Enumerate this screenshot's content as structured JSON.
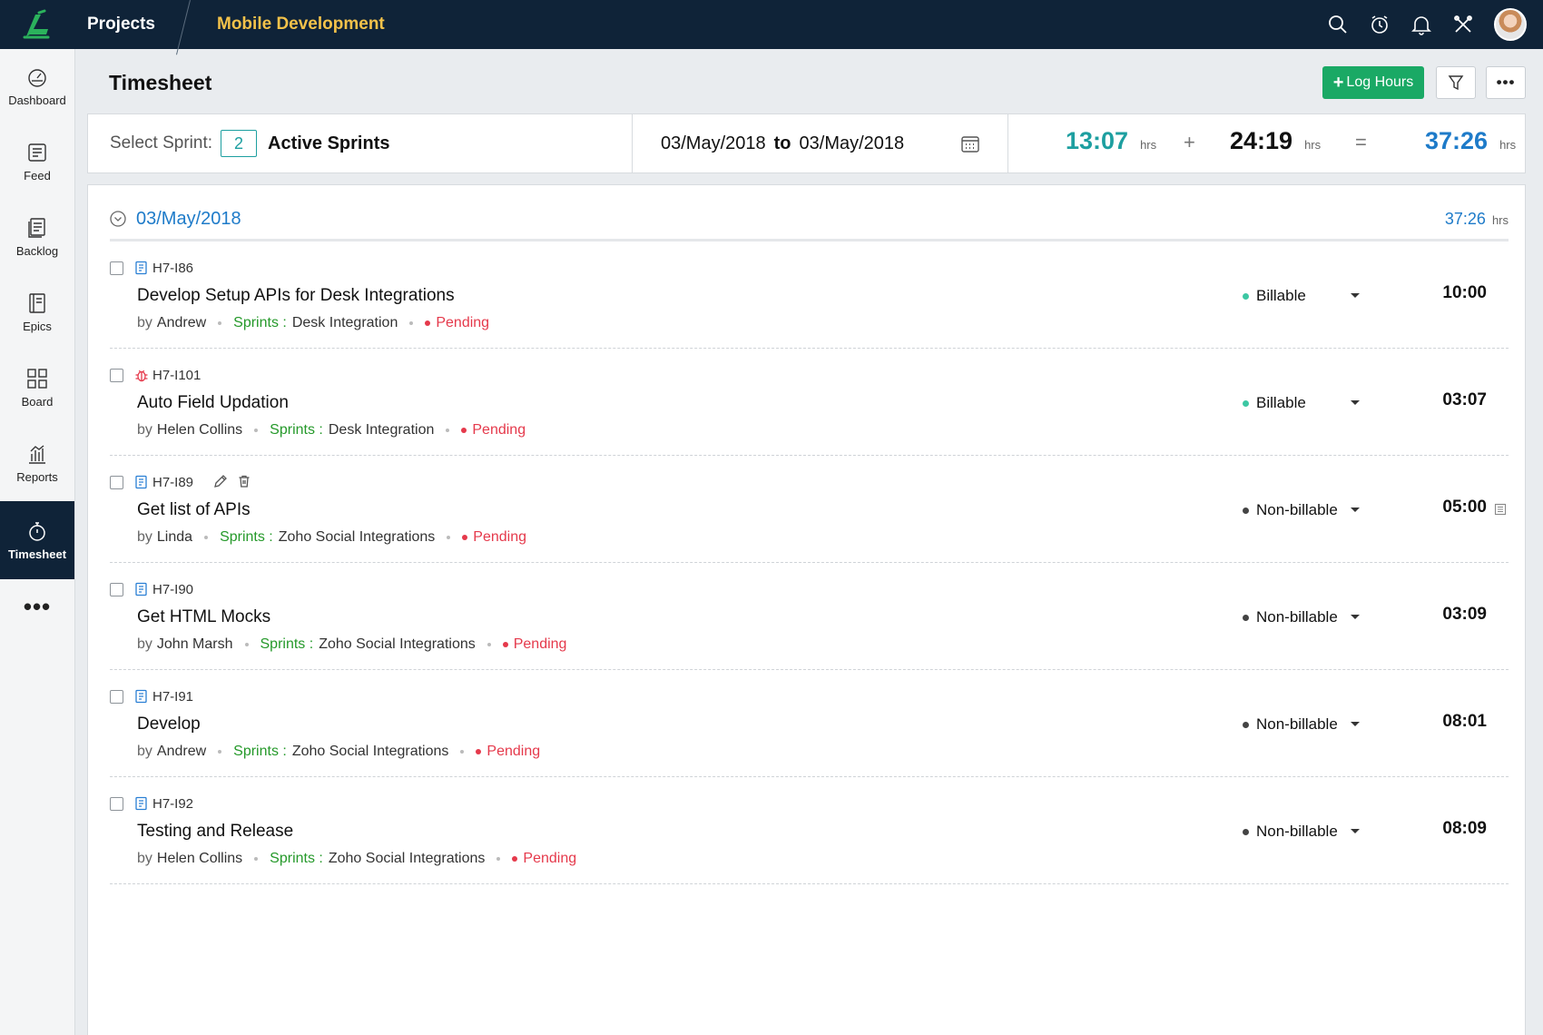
{
  "topbar": {
    "projects_label": "Projects",
    "project_name": "Mobile Development",
    "colors": {
      "bg": "#0f2338",
      "project_accent": "#f3c24a",
      "logo_green": "#2bb25c"
    }
  },
  "sidebar": {
    "items": [
      {
        "label": "Dashboard",
        "icon": "dashboard-gauge-icon"
      },
      {
        "label": "Feed",
        "icon": "feed-icon"
      },
      {
        "label": "Backlog",
        "icon": "backlog-icon"
      },
      {
        "label": "Epics",
        "icon": "epics-book-icon"
      },
      {
        "label": "Board",
        "icon": "board-grid-icon"
      },
      {
        "label": "Reports",
        "icon": "reports-chart-icon"
      },
      {
        "label": "Timesheet",
        "icon": "stopwatch-icon",
        "active": true
      }
    ],
    "more_label": "•••"
  },
  "header": {
    "title": "Timesheet",
    "log_hours_plus": "+",
    "log_hours_label": "Log Hours",
    "more_label": "•••"
  },
  "summary": {
    "select_sprint_label": "Select Sprint:",
    "sprint_count": "2",
    "sprint_name": "Active Sprints",
    "date_from": "03/May/2018",
    "date_to_label": "to",
    "date_to": "03/May/2018",
    "billable_hours": "13:07",
    "nonbillable_hours": "24:19",
    "total_hours": "37:26",
    "unit": "hrs",
    "plus": "+",
    "equals": "="
  },
  "day": {
    "date": "03/May/2018",
    "total": "37:26",
    "unit": "hrs"
  },
  "entries": [
    {
      "id": "H7-I86",
      "type_icon": "task-doc-icon",
      "title": "Develop Setup APIs for Desk Integrations",
      "by_label": "by",
      "author": "Andrew",
      "sprints_label": "Sprints :",
      "sprint": "Desk Integration",
      "status": "Pending",
      "billing": "Billable",
      "billing_color": "#3cc7a3",
      "duration": "10:00"
    },
    {
      "id": "H7-I101",
      "type_icon": "bug-icon",
      "title": "Auto Field Updation",
      "by_label": "by",
      "author": "Helen Collins",
      "sprints_label": "Sprints :",
      "sprint": "Desk Integration",
      "status": "Pending",
      "billing": "Billable",
      "billing_color": "#3cc7a3",
      "duration": "03:07"
    },
    {
      "id": "H7-I89",
      "type_icon": "task-doc-icon",
      "title": "Get list of APIs",
      "by_label": "by",
      "author": "Linda",
      "sprints_label": "Sprints :",
      "sprint": "Zoho Social Integrations",
      "status": "Pending",
      "billing": "Non-billable",
      "billing_color": "#444444",
      "duration": "05:00",
      "has_actions": true,
      "has_note": true
    },
    {
      "id": "H7-I90",
      "type_icon": "task-doc-icon",
      "title": "Get HTML Mocks",
      "by_label": "by",
      "author": "John Marsh",
      "sprints_label": "Sprints :",
      "sprint": "Zoho Social Integrations",
      "status": "Pending",
      "billing": "Non-billable",
      "billing_color": "#444444",
      "duration": "03:09"
    },
    {
      "id": "H7-I91",
      "type_icon": "task-doc-icon",
      "title": "Develop",
      "by_label": "by",
      "author": "Andrew",
      "sprints_label": "Sprints :",
      "sprint": "Zoho Social Integrations",
      "status": "Pending",
      "billing": "Non-billable",
      "billing_color": "#444444",
      "duration": "08:01"
    },
    {
      "id": "H7-I92",
      "type_icon": "task-doc-icon",
      "title": "Testing and Release",
      "by_label": "by",
      "author": "Helen Collins",
      "sprints_label": "Sprints :",
      "sprint": "Zoho Social Integrations",
      "status": "Pending",
      "billing": "Non-billable",
      "billing_color": "#444444",
      "duration": "08:09"
    }
  ],
  "colors": {
    "billable_total": "#1d9fa0",
    "nonbillable_total": "#111111",
    "grand_total": "#1e7bc9",
    "log_hours_button": "#1aa965",
    "sprint_text": "#25992a",
    "pending": "#e5394b"
  }
}
